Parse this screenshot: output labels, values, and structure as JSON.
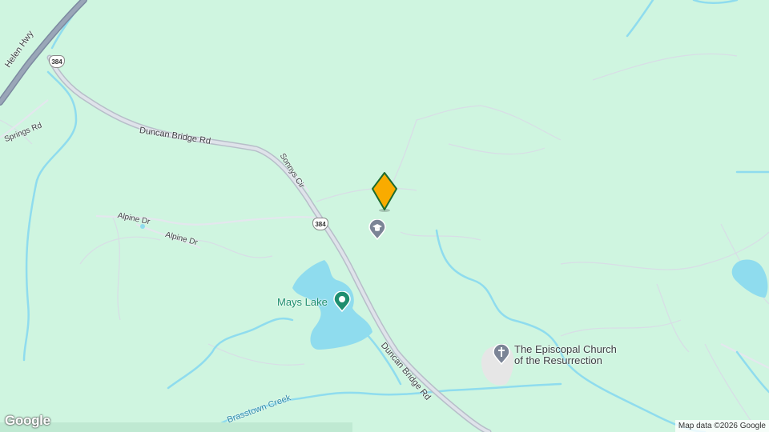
{
  "map": {
    "roads": {
      "helen_hwy": "Helen Hwy",
      "duncan_bridge_1": "Duncan Bridge Rd",
      "duncan_bridge_2": "Duncan Bridge Rd",
      "springs_rd": "Springs Rd",
      "sonnys_cir": "Sonnys Cir",
      "alpine_dr_1": "Alpine Dr",
      "alpine_dr_2": "Alpine Dr"
    },
    "shields": {
      "top": "384",
      "middle": "384"
    },
    "places": {
      "mays_lake": "Mays Lake",
      "church_line1": "The Episcopal Church",
      "church_line2": "of the Resurrection",
      "creek": "Brasstown Creek"
    },
    "colors": {
      "land": "#cff5e0",
      "water": "#8fdcee",
      "highway": "#8e9aae",
      "marker": "#f9ab00"
    },
    "icons": {
      "selected_marker": "orange-diamond-marker",
      "school": "graduation-cap-icon",
      "park": "park-pin-icon",
      "church": "cross-icon"
    },
    "attribution": "Map data ©2026 Google",
    "logo": "Google"
  }
}
